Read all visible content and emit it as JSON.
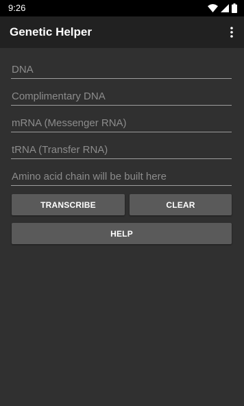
{
  "status_bar": {
    "time": "9:26"
  },
  "app_bar": {
    "title": "Genetic Helper",
    "menu_icon": "more-vert-icon"
  },
  "fields": {
    "dna": {
      "value": "",
      "placeholder": "DNA"
    },
    "complementary_dna": {
      "value": "",
      "placeholder": "Complimentary DNA"
    },
    "mrna": {
      "value": "",
      "placeholder": "mRNA (Messenger RNA)"
    },
    "trna": {
      "value": "",
      "placeholder": "tRNA (Transfer RNA)"
    },
    "amino_acid": {
      "value": "",
      "placeholder": "Amino acid chain will be built here"
    }
  },
  "buttons": {
    "transcribe": "TRANSCRIBE",
    "clear": "CLEAR",
    "help": "HELP"
  },
  "colors": {
    "background": "#303030",
    "app_bar": "#212121",
    "status_bar": "#000000",
    "button": "#5a5a5a",
    "underline": "#9e9e9e"
  }
}
